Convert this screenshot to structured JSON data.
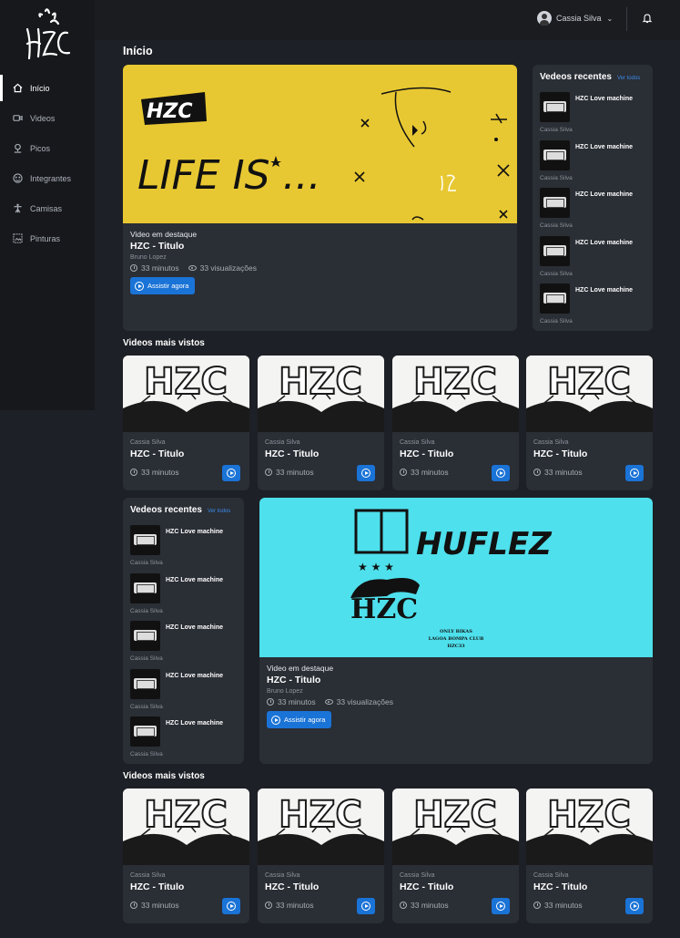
{
  "nav": {
    "items": [
      {
        "label": "Início",
        "icon": "home-icon"
      },
      {
        "label": "Videos",
        "icon": "video-icon"
      },
      {
        "label": "Picos",
        "icon": "map-pin-icon"
      },
      {
        "label": "Integrantes",
        "icon": "users-icon"
      },
      {
        "label": "Camisas",
        "icon": "shirt-icon"
      },
      {
        "label": "Pinturas",
        "icon": "image-icon"
      }
    ],
    "active_index": 0
  },
  "header": {
    "user_name": "Cassia Silva",
    "chevron": "⌄"
  },
  "page_title": "Início",
  "featured_1": {
    "kicker": "Video em destaque",
    "title": "HZC - Titulo",
    "author": "Bruno Lopez",
    "duration": "33 minutos",
    "views": "33 visualizações",
    "button": "Assistir agora",
    "image_text": "LIFE IS ..."
  },
  "featured_2": {
    "kicker": "Video em destaque",
    "title": "HZC - Titulo",
    "author": "Bruno Lopez",
    "duration": "33 minutos",
    "views": "33 visualizações",
    "button": "Assistir agora",
    "image_text_1": "HUFLEZ",
    "image_text_2": "HZC",
    "image_text_3": "ONLY BIKAS",
    "image_text_4": "LAGOA BOMPA CLUB",
    "image_text_5": "HZC33"
  },
  "recent_1": {
    "title": "Vedeos recentes",
    "link": "Ver todos",
    "items": [
      {
        "title": "HZC Love machine",
        "author": "Cassia Silva"
      },
      {
        "title": "HZC Love machine",
        "author": "Cassia Silva"
      },
      {
        "title": "HZC Love machine",
        "author": "Cassia Silva"
      },
      {
        "title": "HZC Love machine",
        "author": "Cassia Silva"
      },
      {
        "title": "HZC Love machine",
        "author": "Cassia Silva"
      }
    ]
  },
  "recent_2": {
    "title": "Vedeos recentes",
    "link": "Ver todos",
    "items": [
      {
        "title": "HZC Love machine",
        "author": "Cassia Silva"
      },
      {
        "title": "HZC Love machine",
        "author": "Cassia Silva"
      },
      {
        "title": "HZC Love machine",
        "author": "Cassia Silva"
      },
      {
        "title": "HZC Love machine",
        "author": "Cassia Silva"
      },
      {
        "title": "HZC Love machine",
        "author": "Cassia Silva"
      }
    ]
  },
  "most_viewed_1": {
    "title": "Videos mais vistos",
    "cards": [
      {
        "author": "Cassia Silva",
        "title": "HZC - Titulo",
        "duration": "33 minutos"
      },
      {
        "author": "Cassia Silva",
        "title": "HZC - Titulo",
        "duration": "33 minutos"
      },
      {
        "author": "Cassia Silva",
        "title": "HZC - Titulo",
        "duration": "33 minutos"
      },
      {
        "author": "Cassia Silva",
        "title": "HZC - Titulo",
        "duration": "33 minutos"
      }
    ]
  },
  "most_viewed_2": {
    "title": "Videos mais vistos",
    "cards": [
      {
        "author": "Cassia Silva",
        "title": "HZC - Titulo",
        "duration": "33 minutos"
      },
      {
        "author": "Cassia Silva",
        "title": "HZC - Titulo",
        "duration": "33 minutos"
      },
      {
        "author": "Cassia Silva",
        "title": "HZC - Titulo",
        "duration": "33 minutos"
      },
      {
        "author": "Cassia Silva",
        "title": "HZC - Titulo",
        "duration": "33 minutos"
      }
    ]
  },
  "thumb_text": "HZC",
  "colors": {
    "accent": "#1a73d6",
    "featured_1_bg": "#e8c832",
    "featured_2_bg": "#4ee0ec"
  }
}
